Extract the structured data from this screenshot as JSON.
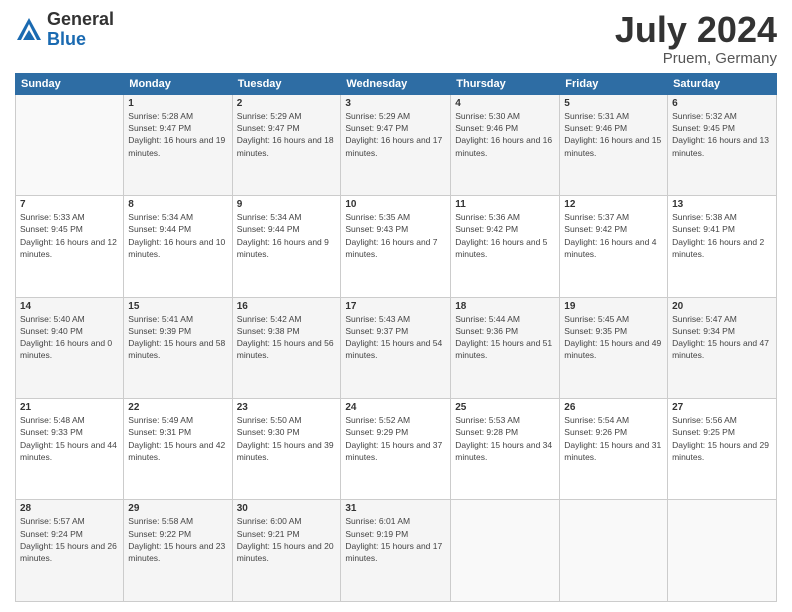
{
  "header": {
    "logo_general": "General",
    "logo_blue": "Blue",
    "month_title": "July 2024",
    "subtitle": "Pruem, Germany"
  },
  "days_of_week": [
    "Sunday",
    "Monday",
    "Tuesday",
    "Wednesday",
    "Thursday",
    "Friday",
    "Saturday"
  ],
  "weeks": [
    [
      {
        "day": "",
        "sunrise": "",
        "sunset": "",
        "daylight": ""
      },
      {
        "day": "1",
        "sunrise": "Sunrise: 5:28 AM",
        "sunset": "Sunset: 9:47 PM",
        "daylight": "Daylight: 16 hours and 19 minutes."
      },
      {
        "day": "2",
        "sunrise": "Sunrise: 5:29 AM",
        "sunset": "Sunset: 9:47 PM",
        "daylight": "Daylight: 16 hours and 18 minutes."
      },
      {
        "day": "3",
        "sunrise": "Sunrise: 5:29 AM",
        "sunset": "Sunset: 9:47 PM",
        "daylight": "Daylight: 16 hours and 17 minutes."
      },
      {
        "day": "4",
        "sunrise": "Sunrise: 5:30 AM",
        "sunset": "Sunset: 9:46 PM",
        "daylight": "Daylight: 16 hours and 16 minutes."
      },
      {
        "day": "5",
        "sunrise": "Sunrise: 5:31 AM",
        "sunset": "Sunset: 9:46 PM",
        "daylight": "Daylight: 16 hours and 15 minutes."
      },
      {
        "day": "6",
        "sunrise": "Sunrise: 5:32 AM",
        "sunset": "Sunset: 9:45 PM",
        "daylight": "Daylight: 16 hours and 13 minutes."
      }
    ],
    [
      {
        "day": "7",
        "sunrise": "Sunrise: 5:33 AM",
        "sunset": "Sunset: 9:45 PM",
        "daylight": "Daylight: 16 hours and 12 minutes."
      },
      {
        "day": "8",
        "sunrise": "Sunrise: 5:34 AM",
        "sunset": "Sunset: 9:44 PM",
        "daylight": "Daylight: 16 hours and 10 minutes."
      },
      {
        "day": "9",
        "sunrise": "Sunrise: 5:34 AM",
        "sunset": "Sunset: 9:44 PM",
        "daylight": "Daylight: 16 hours and 9 minutes."
      },
      {
        "day": "10",
        "sunrise": "Sunrise: 5:35 AM",
        "sunset": "Sunset: 9:43 PM",
        "daylight": "Daylight: 16 hours and 7 minutes."
      },
      {
        "day": "11",
        "sunrise": "Sunrise: 5:36 AM",
        "sunset": "Sunset: 9:42 PM",
        "daylight": "Daylight: 16 hours and 5 minutes."
      },
      {
        "day": "12",
        "sunrise": "Sunrise: 5:37 AM",
        "sunset": "Sunset: 9:42 PM",
        "daylight": "Daylight: 16 hours and 4 minutes."
      },
      {
        "day": "13",
        "sunrise": "Sunrise: 5:38 AM",
        "sunset": "Sunset: 9:41 PM",
        "daylight": "Daylight: 16 hours and 2 minutes."
      }
    ],
    [
      {
        "day": "14",
        "sunrise": "Sunrise: 5:40 AM",
        "sunset": "Sunset: 9:40 PM",
        "daylight": "Daylight: 16 hours and 0 minutes."
      },
      {
        "day": "15",
        "sunrise": "Sunrise: 5:41 AM",
        "sunset": "Sunset: 9:39 PM",
        "daylight": "Daylight: 15 hours and 58 minutes."
      },
      {
        "day": "16",
        "sunrise": "Sunrise: 5:42 AM",
        "sunset": "Sunset: 9:38 PM",
        "daylight": "Daylight: 15 hours and 56 minutes."
      },
      {
        "day": "17",
        "sunrise": "Sunrise: 5:43 AM",
        "sunset": "Sunset: 9:37 PM",
        "daylight": "Daylight: 15 hours and 54 minutes."
      },
      {
        "day": "18",
        "sunrise": "Sunrise: 5:44 AM",
        "sunset": "Sunset: 9:36 PM",
        "daylight": "Daylight: 15 hours and 51 minutes."
      },
      {
        "day": "19",
        "sunrise": "Sunrise: 5:45 AM",
        "sunset": "Sunset: 9:35 PM",
        "daylight": "Daylight: 15 hours and 49 minutes."
      },
      {
        "day": "20",
        "sunrise": "Sunrise: 5:47 AM",
        "sunset": "Sunset: 9:34 PM",
        "daylight": "Daylight: 15 hours and 47 minutes."
      }
    ],
    [
      {
        "day": "21",
        "sunrise": "Sunrise: 5:48 AM",
        "sunset": "Sunset: 9:33 PM",
        "daylight": "Daylight: 15 hours and 44 minutes."
      },
      {
        "day": "22",
        "sunrise": "Sunrise: 5:49 AM",
        "sunset": "Sunset: 9:31 PM",
        "daylight": "Daylight: 15 hours and 42 minutes."
      },
      {
        "day": "23",
        "sunrise": "Sunrise: 5:50 AM",
        "sunset": "Sunset: 9:30 PM",
        "daylight": "Daylight: 15 hours and 39 minutes."
      },
      {
        "day": "24",
        "sunrise": "Sunrise: 5:52 AM",
        "sunset": "Sunset: 9:29 PM",
        "daylight": "Daylight: 15 hours and 37 minutes."
      },
      {
        "day": "25",
        "sunrise": "Sunrise: 5:53 AM",
        "sunset": "Sunset: 9:28 PM",
        "daylight": "Daylight: 15 hours and 34 minutes."
      },
      {
        "day": "26",
        "sunrise": "Sunrise: 5:54 AM",
        "sunset": "Sunset: 9:26 PM",
        "daylight": "Daylight: 15 hours and 31 minutes."
      },
      {
        "day": "27",
        "sunrise": "Sunrise: 5:56 AM",
        "sunset": "Sunset: 9:25 PM",
        "daylight": "Daylight: 15 hours and 29 minutes."
      }
    ],
    [
      {
        "day": "28",
        "sunrise": "Sunrise: 5:57 AM",
        "sunset": "Sunset: 9:24 PM",
        "daylight": "Daylight: 15 hours and 26 minutes."
      },
      {
        "day": "29",
        "sunrise": "Sunrise: 5:58 AM",
        "sunset": "Sunset: 9:22 PM",
        "daylight": "Daylight: 15 hours and 23 minutes."
      },
      {
        "day": "30",
        "sunrise": "Sunrise: 6:00 AM",
        "sunset": "Sunset: 9:21 PM",
        "daylight": "Daylight: 15 hours and 20 minutes."
      },
      {
        "day": "31",
        "sunrise": "Sunrise: 6:01 AM",
        "sunset": "Sunset: 9:19 PM",
        "daylight": "Daylight: 15 hours and 17 minutes."
      },
      {
        "day": "",
        "sunrise": "",
        "sunset": "",
        "daylight": ""
      },
      {
        "day": "",
        "sunrise": "",
        "sunset": "",
        "daylight": ""
      },
      {
        "day": "",
        "sunrise": "",
        "sunset": "",
        "daylight": ""
      }
    ]
  ]
}
